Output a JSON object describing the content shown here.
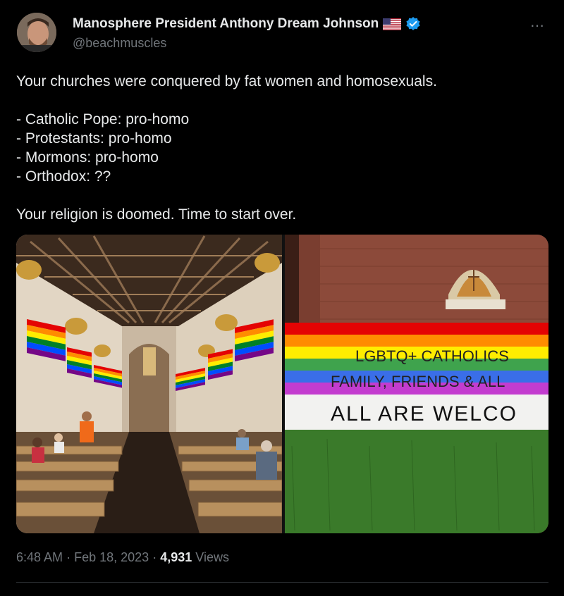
{
  "author": {
    "display_name": "Manosphere President Anthony Dream Johnson",
    "handle": "@beachmuscles",
    "flag_icon": "us-flag-icon",
    "verified_icon": "verified-badge-icon",
    "verified_color": "#1d9bf0"
  },
  "tweet": {
    "text": "Your churches were conquered by fat women and homosexuals.\n\n- Catholic Pope: pro-homo\n- Protestants: pro-homo\n- Mormons: pro-homo\n- Orthodox: ??\n\nYour religion is doomed. Time to start over."
  },
  "media": {
    "banner_line1": "LGBTQ+ CATHOLICS",
    "banner_line2": "FAMILY, FRIENDS & ALL",
    "banner_line3": "ALL ARE WELCO"
  },
  "meta": {
    "time": "6:48 AM",
    "separator": "·",
    "date": "Feb 18, 2023",
    "views_count": "4,931",
    "views_label": "Views"
  },
  "more_icon": "⋯"
}
